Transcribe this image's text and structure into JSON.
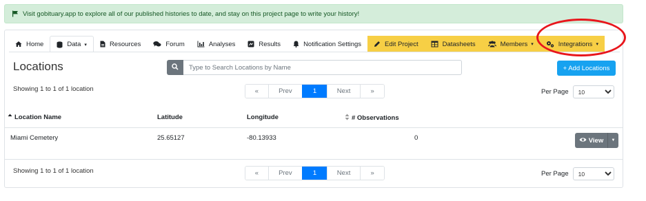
{
  "alert": {
    "text": "Visit gobituary.app to explore all of our published histories to date, and stay on this project page to write your history!",
    "icon": "flag-icon"
  },
  "tabs": [
    {
      "label": "Home",
      "icon": "home-icon"
    },
    {
      "label": "Data",
      "icon": "database-icon",
      "caret": "▾"
    },
    {
      "label": "Resources",
      "icon": "file-icon"
    },
    {
      "label": "Forum",
      "icon": "comments-icon"
    },
    {
      "label": "Analyses",
      "icon": "chart-icon"
    },
    {
      "label": "Results",
      "icon": "square-icon"
    },
    {
      "label": "Notification Settings",
      "icon": "bell-icon"
    },
    {
      "label": "Edit Project",
      "icon": "pencil-icon"
    },
    {
      "label": "Datasheets",
      "icon": "table-icon"
    },
    {
      "label": "Members",
      "icon": "users-icon",
      "caret": "▾"
    },
    {
      "label": "Integrations",
      "icon": "cogs-icon",
      "caret": "▾"
    }
  ],
  "page": {
    "title": "Locations"
  },
  "search": {
    "placeholder": "Type to Search Locations by Name",
    "value": ""
  },
  "add_button": {
    "label": "+ Add Locations"
  },
  "summary": {
    "top": "Showing 1 to 1 of 1 location",
    "bottom": "Showing 1 to 1 of 1 location"
  },
  "pagination": {
    "first": "«",
    "prev": "Prev",
    "current": "1",
    "next": "Next",
    "last": "»"
  },
  "per_page": {
    "label": "Per Page",
    "value": "10"
  },
  "table": {
    "headers": {
      "name": "Location Name",
      "latitude": "Latitude",
      "longitude": "Longitude",
      "observations": "# Observations"
    },
    "rows": [
      {
        "name": "Miami Cemetery",
        "latitude": "25.65127",
        "longitude": "-80.13933",
        "observations": "0",
        "action": "View"
      }
    ]
  },
  "colors": {
    "primary": "#007bff",
    "info": "#17a2f0",
    "secondary": "#6c757d",
    "warning": "#f7cf45",
    "success_bg": "#d4edda",
    "highlight": "#e8161c"
  }
}
